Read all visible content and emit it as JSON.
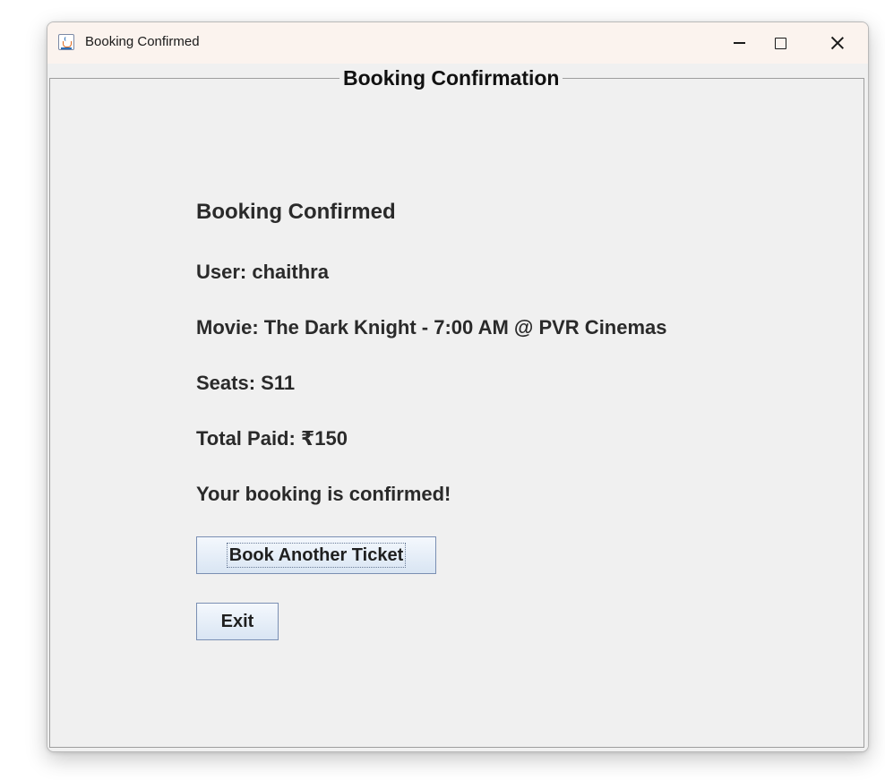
{
  "window": {
    "title": "Booking Confirmed",
    "icon": "java-app-icon"
  },
  "titlebar_controls": {
    "minimize": "minimize-icon",
    "maximize": "maximize-icon",
    "close": "close-icon"
  },
  "panel": {
    "border_title": "Booking Confirmation"
  },
  "confirmation": {
    "heading": "Booking Confirmed",
    "user": "User: chaithra",
    "movie": "Movie: The Dark Knight - 7:00 AM @ PVR Cinemas",
    "seats": "Seats: S11",
    "total": "Total Paid: ₹150",
    "message": "Your booking is confirmed!"
  },
  "buttons": {
    "book_another": "Book Another Ticket",
    "exit": "Exit"
  }
}
